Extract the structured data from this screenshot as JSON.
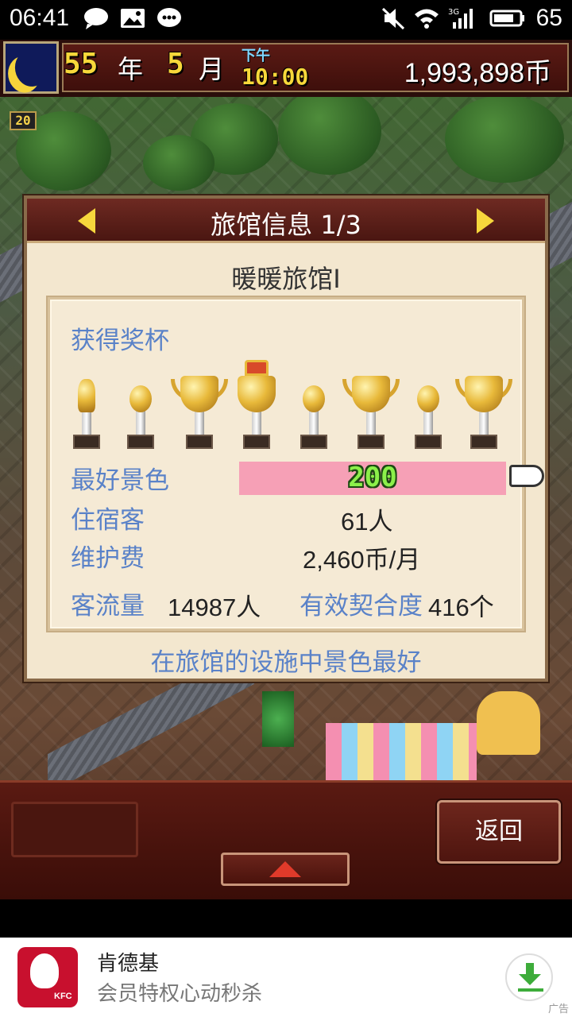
{
  "status_bar": {
    "time": "06:41",
    "battery": "65",
    "icons": [
      "chat-bubble-icon",
      "image-icon",
      "wechat-icon",
      "mute-icon",
      "wifi-icon",
      "signal-3g-icon",
      "battery-icon"
    ]
  },
  "hud": {
    "year_number": "55",
    "year_unit": "年",
    "month_number": "5",
    "month_unit": "月",
    "ampm": "下午",
    "clock": "10:00",
    "money": "1,993,898币",
    "level": "20"
  },
  "dialog": {
    "title": "旅馆信息 1/3",
    "inn_name": "暖暖旅馆I",
    "trophy_label": "获得奖杯",
    "trophies": [
      "small-gold-trophy",
      "silver-ball-trophy",
      "large-gold-trophy",
      "crown-trophy",
      "silver-ball-trophy",
      "large-gold-trophy",
      "silver-ball-trophy",
      "large-gold-trophy"
    ],
    "best_scenery_label": "最好景色",
    "best_scenery_value": "200",
    "guests_label": "住宿客",
    "guests_value": "61人",
    "maintenance_label": "维护费",
    "maintenance_value": "2,460币/月",
    "traffic_label": "客流量",
    "traffic_value": "14987人",
    "compat_label": "有效契合度",
    "compat_value": "416个",
    "footer_note": "在旅馆的设施中景色最好"
  },
  "bottom_bar": {
    "back_label": "返回"
  },
  "ad": {
    "title": "肯德基",
    "subtitle": "会员特权心动秒杀",
    "logo_text": "KFC",
    "tag": "广告"
  },
  "colors": {
    "label_blue": "#5a82c8",
    "header_red": "#5a1e18",
    "scenery_pink": "#f6a0b6",
    "gold": "#f6d73c"
  }
}
